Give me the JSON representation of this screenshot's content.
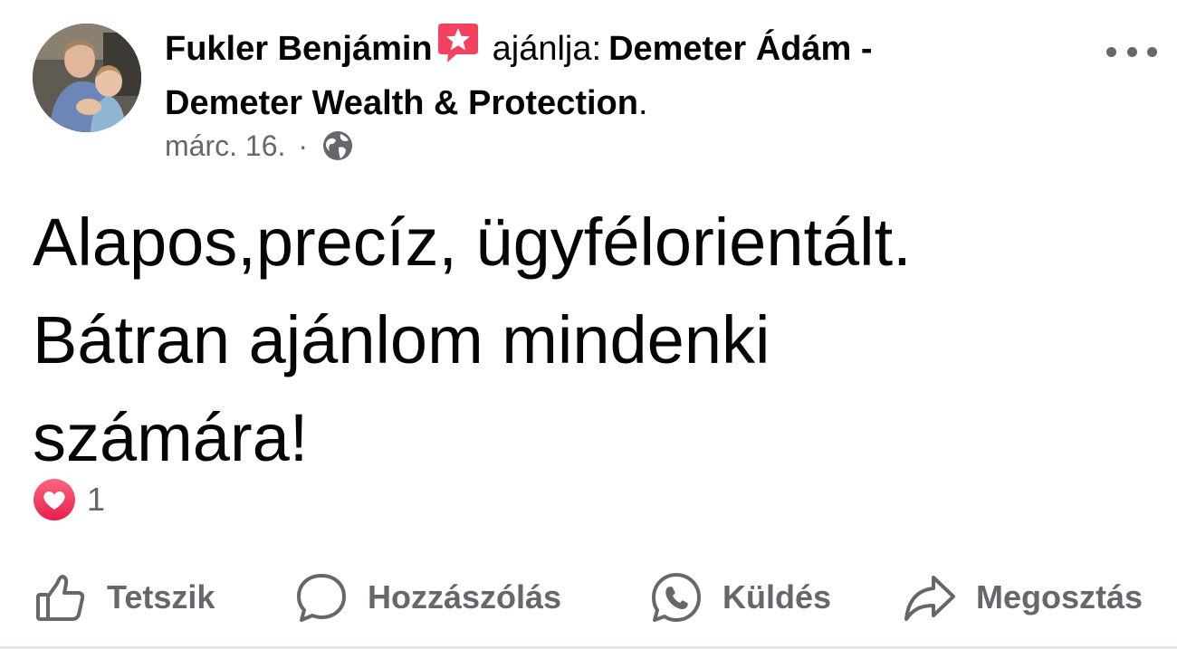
{
  "post": {
    "author": "Fukler Benjámin",
    "verb": "ajánlja:",
    "page_line1": "Demeter Ádám -",
    "page_line2": "Demeter Wealth & Protection",
    "page_end": ".",
    "date": "márc. 16.",
    "dot": "·",
    "visibility_icon": "globe-icon",
    "body_line1": "Alapos,precíz, ügyfélorientált.",
    "body_line2": "Bátran ajánlom mindenki",
    "body_line3": "számára!",
    "reaction_icon": "heart-icon",
    "reaction_count": "1"
  },
  "actions": {
    "like": "Tetszik",
    "comment": "Hozzászólás",
    "send": "Küldés",
    "share": "Megosztás"
  },
  "colors": {
    "text": "#050505",
    "secondary": "#65676b",
    "recommend_badge": "#f3425f",
    "heart_badge": "#f33e58",
    "divider": "#e4e6eb"
  }
}
